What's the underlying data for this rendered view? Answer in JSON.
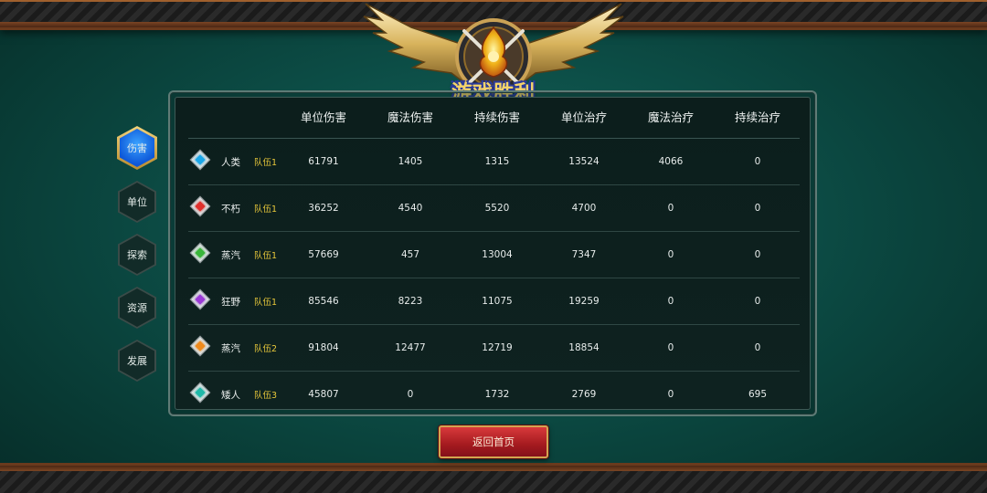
{
  "title": "游戏胜利",
  "side_tabs": [
    {
      "label": "伤害",
      "active": true
    },
    {
      "label": "单位",
      "active": false
    },
    {
      "label": "探索",
      "active": false
    },
    {
      "label": "资源",
      "active": false
    },
    {
      "label": "发展",
      "active": false
    }
  ],
  "table": {
    "headers": [
      "单位伤害",
      "魔法伤害",
      "持续伤害",
      "单位治疗",
      "魔法治疗",
      "持续治疗"
    ],
    "rows": [
      {
        "race": "人类",
        "team": "队伍1",
        "gem_color": "#1aa6e8",
        "values": [
          "61791",
          "1405",
          "1315",
          "13524",
          "4066",
          "0"
        ]
      },
      {
        "race": "不朽",
        "team": "队伍1",
        "gem_color": "#e0302c",
        "values": [
          "36252",
          "4540",
          "5520",
          "4700",
          "0",
          "0"
        ]
      },
      {
        "race": "蒸汽",
        "team": "队伍1",
        "gem_color": "#39b53a",
        "values": [
          "57669",
          "457",
          "13004",
          "7347",
          "0",
          "0"
        ]
      },
      {
        "race": "狂野",
        "team": "队伍1",
        "gem_color": "#9a3ad6",
        "values": [
          "85546",
          "8223",
          "11075",
          "19259",
          "0",
          "0"
        ]
      },
      {
        "race": "蒸汽",
        "team": "队伍2",
        "gem_color": "#ef8a1c",
        "values": [
          "91804",
          "12477",
          "12719",
          "18854",
          "0",
          "0"
        ]
      },
      {
        "race": "矮人",
        "team": "队伍3",
        "gem_color": "#1fb8a8",
        "values": [
          "45807",
          "0",
          "1732",
          "2769",
          "0",
          "695"
        ]
      }
    ]
  },
  "buttons": {
    "return_label": "返回首页"
  },
  "icons": {
    "emblem": "winged-crest-icon",
    "gem": "diamond-gem-icon"
  }
}
